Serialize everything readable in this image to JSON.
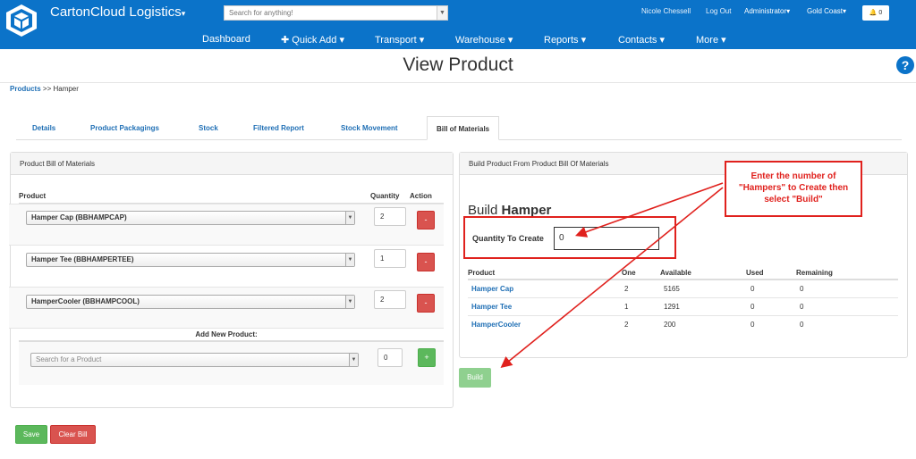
{
  "app": {
    "brand": "CartonCloud Logistics",
    "brand_caret": "▾",
    "search_placeholder": "Search for anything!",
    "user": "Nicole Chessell",
    "logout": "Log Out",
    "role": "Administrator▾",
    "location": "Gold Coast▾",
    "notifications": "0"
  },
  "nav": [
    "Dashboard",
    "✚ Quick Add ▾",
    "Transport ▾",
    "Warehouse ▾",
    "Reports ▾",
    "Contacts ▾",
    "More ▾"
  ],
  "page": {
    "title": "View Product",
    "help": "?"
  },
  "breadcrumb": {
    "root": "Products",
    "sep": " >> ",
    "current": "Hamper"
  },
  "tabs": [
    "Details",
    "Product Packagings",
    "Stock",
    "Filtered Report",
    "Stock Movement",
    "Bill of Materials"
  ],
  "bill": {
    "heading": "Product Bill of Materials",
    "col_product": "Product",
    "col_quantity": "Quantity",
    "col_action": "Action",
    "rows": [
      {
        "product": "Hamper Cap (BBHAMPCAP)",
        "qty": "2"
      },
      {
        "product": "Hamper Tee (BBHAMPERTEE)",
        "qty": "1"
      },
      {
        "product": "HamperCooler (BBHAMPCOOL)",
        "qty": "2"
      }
    ],
    "remove_label": "-",
    "add_heading": "Add New Product:",
    "add_placeholder": "Search for a Product",
    "add_qty": "0",
    "add_label": "+"
  },
  "build": {
    "heading": "Build Product From Product Bill Of Materials",
    "title_prefix": "Build",
    "title_product": "Hamper",
    "qty_label": "Quantity To Create",
    "qty_value": "0",
    "col_product": "Product",
    "col_one": "One",
    "col_available": "Available",
    "col_used": "Used",
    "col_remaining": "Remaining",
    "rows": [
      {
        "product": "Hamper Cap",
        "one": "2",
        "available": "5165",
        "used": "0",
        "remaining": "0"
      },
      {
        "product": "Hamper Tee",
        "one": "1",
        "available": "1291",
        "used": "0",
        "remaining": "0"
      },
      {
        "product": "HamperCooler",
        "one": "2",
        "available": "200",
        "used": "0",
        "remaining": "0"
      }
    ],
    "build_label": "Build"
  },
  "annotation": {
    "line1": "Enter the number of",
    "line2": "\"Hampers\" to Create then",
    "line3": "select \"Build\""
  },
  "actions": {
    "save": "Save",
    "clear": "Clear Bill"
  },
  "colors": {
    "brand": "#0b73c9",
    "danger": "#d9534f",
    "success": "#5cb85c",
    "annotation": "#e0211d"
  }
}
